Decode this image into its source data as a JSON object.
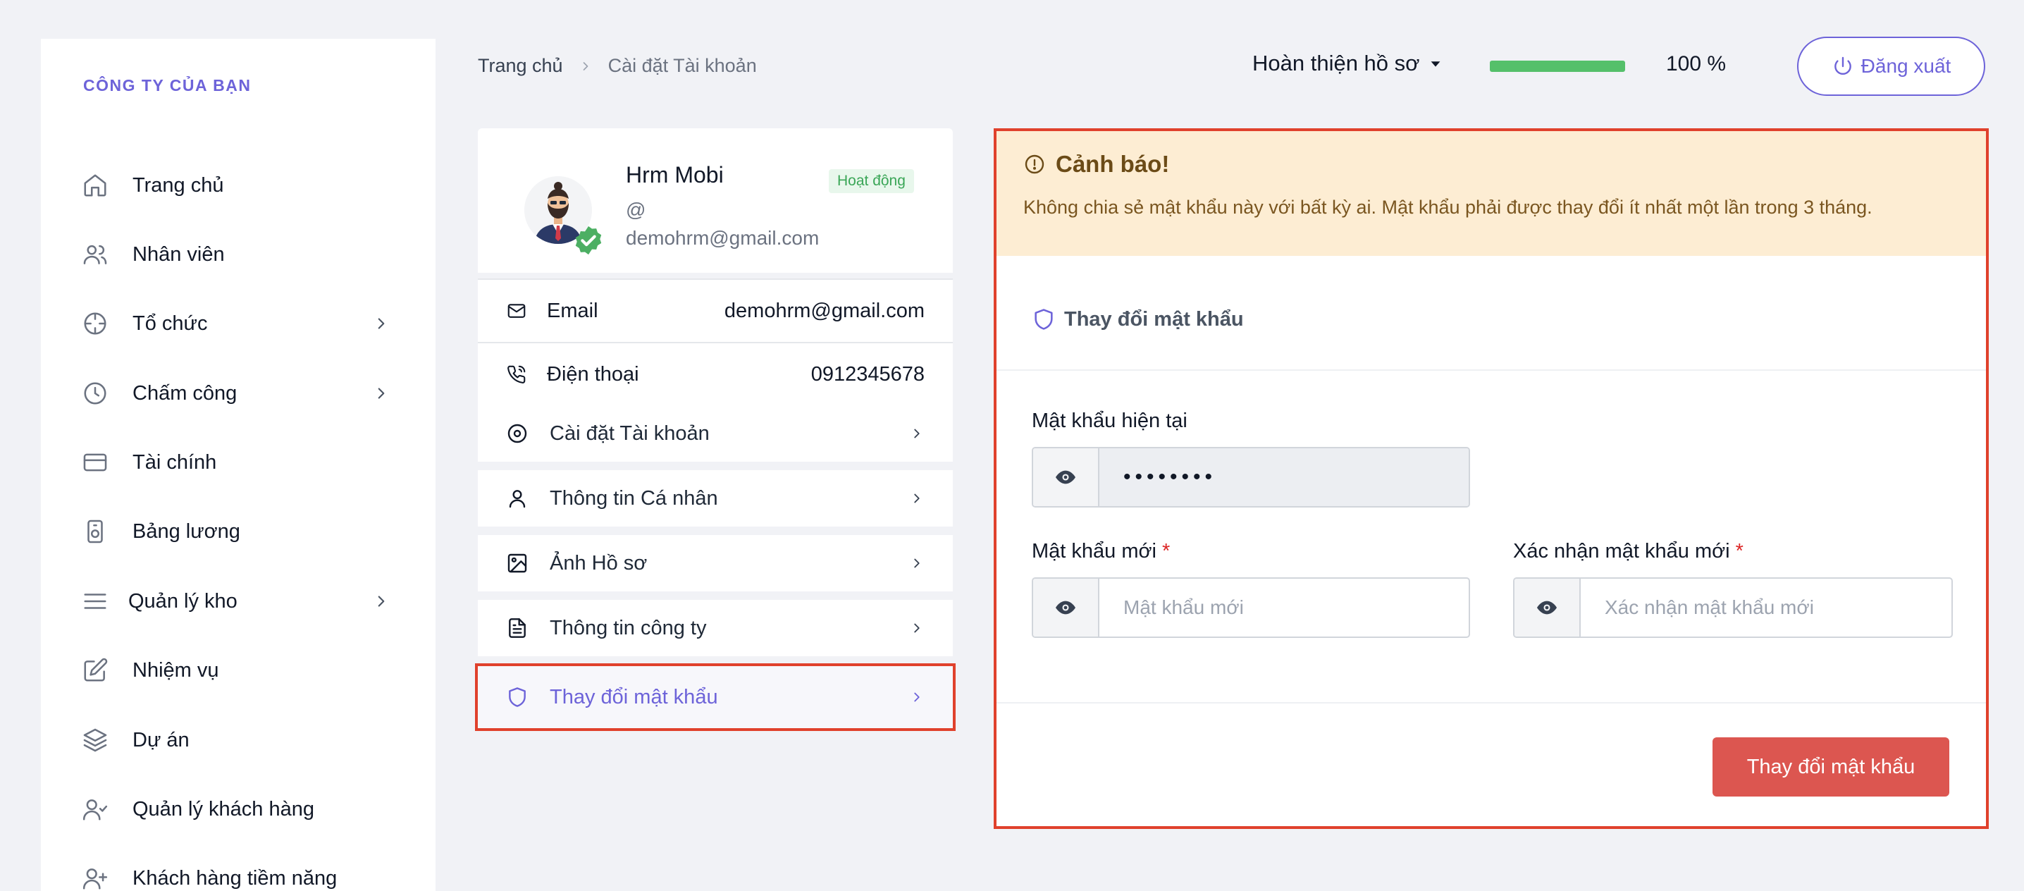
{
  "sidebar": {
    "company": "CÔNG TY CỦA BẠN",
    "items": [
      {
        "label": "Trang chủ",
        "icon": "home-icon",
        "has_children": false
      },
      {
        "label": "Nhân viên",
        "icon": "users-icon",
        "has_children": false
      },
      {
        "label": "Tổ chức",
        "icon": "crosshair-icon",
        "has_children": true
      },
      {
        "label": "Chấm công",
        "icon": "clock-icon",
        "has_children": true
      },
      {
        "label": "Tài chính",
        "icon": "credit-card-icon",
        "has_children": false
      },
      {
        "label": "Bảng lương",
        "icon": "safe-icon",
        "has_children": false
      },
      {
        "label": "Quản lý kho",
        "icon": "menu-icon",
        "has_children": true
      },
      {
        "label": "Nhiệm vụ",
        "icon": "edit-icon",
        "has_children": false
      },
      {
        "label": "Dự án",
        "icon": "layers-icon",
        "has_children": false
      },
      {
        "label": "Quản lý khách hàng",
        "icon": "user-check-icon",
        "has_children": false
      },
      {
        "label": "Khách hàng tiềm năng",
        "icon": "user-plus-icon",
        "has_children": false
      }
    ]
  },
  "breadcrumb": {
    "home": "Trang chủ",
    "current": "Cài đặt Tài khoản"
  },
  "header": {
    "profile_complete_label": "Hoàn thiện hồ sơ",
    "progress_percent": 100,
    "progress_text": "100 %",
    "logout_label": "Đăng xuất",
    "progress_color": "#55c06a",
    "accent_color": "#6d63d9"
  },
  "profile": {
    "name": "Hrm Mobi",
    "status": "Hoạt động",
    "at": "@",
    "email_sub": "demohrm@gmail.com",
    "info": [
      {
        "label": "Email",
        "value": "demohrm@gmail.com",
        "icon": "mail-icon"
      },
      {
        "label": "Điện thoại",
        "value": "0912345678",
        "icon": "phone-icon"
      }
    ],
    "menu": [
      {
        "label": "Cài đặt Tài khoản",
        "icon": "disc-icon"
      },
      {
        "label": "Thông tin Cá nhân",
        "icon": "user-icon"
      },
      {
        "label": "Ảnh Hồ sơ",
        "icon": "image-icon"
      },
      {
        "label": "Thông tin công ty",
        "icon": "file-text-icon"
      },
      {
        "label": "Thay đổi mật khẩu",
        "icon": "shield-icon",
        "active": true
      }
    ]
  },
  "alert": {
    "title": "Cảnh báo!",
    "text": "Không chia sẻ mật khẩu này với bất kỳ ai. Mật khẩu phải được thay đổi ít nhất một lần trong 3 tháng.",
    "bg_color": "#fdedd3"
  },
  "password_form": {
    "section_title": "Thay đổi mật khẩu",
    "current_label": "Mật khẩu hiện tại",
    "current_value": "••••••••",
    "new_label": "Mật khẩu mới",
    "new_placeholder": "Mật khẩu mới",
    "confirm_label": "Xác nhận mật khẩu mới",
    "confirm_placeholder": "Xác nhận mật khẩu mới",
    "required_mark": "*",
    "submit_label": "Thay đổi mật khẩu",
    "submit_color": "#dc5650"
  }
}
